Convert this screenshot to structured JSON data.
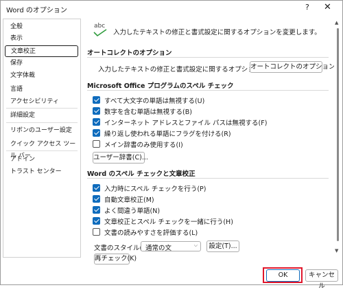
{
  "window": {
    "title": "Word のオプション",
    "help_glyph": "?",
    "close_glyph": "✕"
  },
  "sidebar": {
    "items": [
      {
        "label": "全般"
      },
      {
        "label": "表示"
      },
      {
        "label": "文章校正",
        "selected": true
      },
      {
        "label": "保存"
      },
      {
        "label": "文字体裁"
      },
      {
        "label": "言語"
      },
      {
        "label": "アクセシビリティ"
      },
      {
        "label": "詳細設定"
      },
      {
        "label": "リボンのユーザー設定"
      },
      {
        "label": "クイック アクセス ツール バー"
      },
      {
        "label": "アドイン"
      },
      {
        "label": "トラスト センター"
      }
    ]
  },
  "header": {
    "icon_text": "abc",
    "description": "入力したテキストの修正と書式設定に関するオプションを変更します。"
  },
  "autocorrect": {
    "heading": "オートコレクトのオプション",
    "description": "入力したテキストの修正と書式設定に関するオプションを変更します。",
    "button_label": "オートコレクトのオプション(A)..."
  },
  "office_spelling": {
    "heading": "Microsoft Office プログラムのスペル チェック",
    "options": [
      {
        "label": "すべて大文字の単語は無視する(U)",
        "checked": true
      },
      {
        "label": "数字を含む単語は無視する(B)",
        "checked": true
      },
      {
        "label": "インターネット アドレスとファイル パスは無視する(F)",
        "checked": true
      },
      {
        "label": "繰り返し使われる単語にフラグを付ける(R)",
        "checked": true
      },
      {
        "label": "メイン辞書のみ使用する(I)",
        "checked": false
      }
    ],
    "dictionary_button": "ユーザー辞書(C)..."
  },
  "word_spelling": {
    "heading": "Word のスペル チェックと文章校正",
    "options": [
      {
        "label": "入力時にスペル チェックを行う(P)",
        "checked": true
      },
      {
        "label": "自動文章校正(M)",
        "checked": true
      },
      {
        "label": "よく間違う単語(N)",
        "checked": true
      },
      {
        "label": "文章校正とスペル チェックを一緒に行う(H)",
        "checked": true
      },
      {
        "label": "文書の読みやすさを評価する(L)",
        "checked": false
      }
    ],
    "style_label": "文書のスタイル(W):",
    "style_value": "通常の文",
    "settings_button": "設定(T)...",
    "recheck_button": "再チェック(K)"
  },
  "footer": {
    "ok_label": "OK",
    "cancel_label": "キャンセル"
  },
  "colors": {
    "accent": "#0f6cbd",
    "highlight": "#e0162b",
    "check_mark": "#2e9b3c"
  }
}
